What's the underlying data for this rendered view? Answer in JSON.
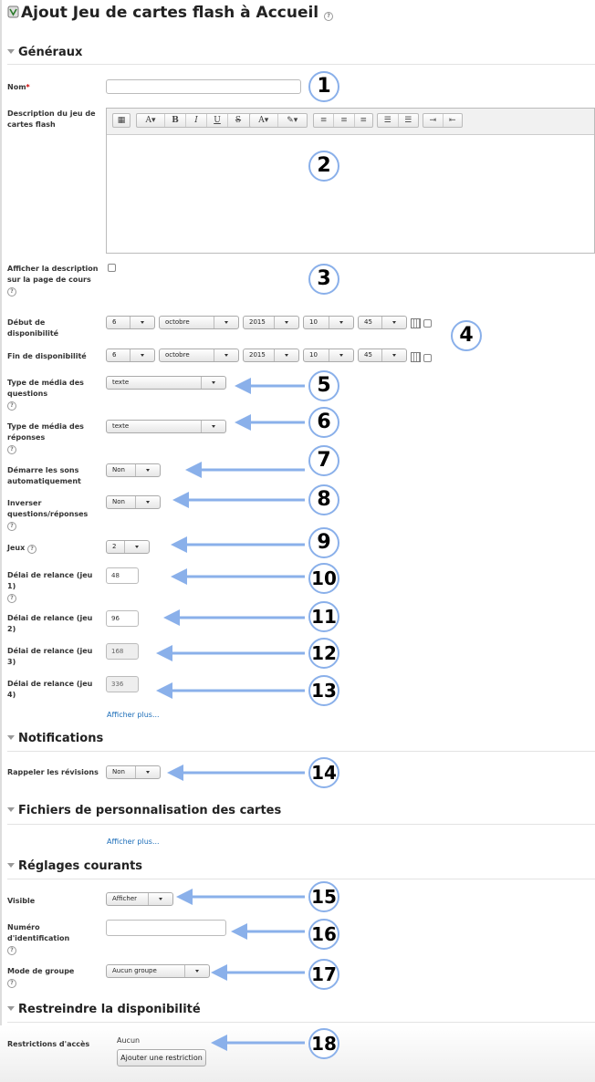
{
  "page": {
    "title": "Ajout Jeu de cartes flash à Accueil"
  },
  "sections": {
    "general": "Généraux",
    "notifications": "Notifications",
    "custom_files": "Fichiers de personnalisation des cartes",
    "common": "Réglages courants",
    "restrict": "Restreindre la disponibilité"
  },
  "labels": {
    "name": "Nom",
    "description": "Description du jeu de cartes flash",
    "show_desc": "Afficher la description sur la page de cours",
    "start": "Début de disponibilité",
    "end": "Fin de disponibilité",
    "q_media": "Type de média des questions",
    "a_media": "Type de média des réponses",
    "autoplay": "Démarre les sons automatiquement",
    "invert": "Inverser questions/réponses",
    "decks": "Jeux",
    "delay1": "Délai de relance (jeu 1)",
    "delay2": "Délai de relance (jeu 2)",
    "delay3": "Délai de relance (jeu 3)",
    "delay4": "Délai de relance (jeu 4)",
    "remind": "Rappeler les révisions",
    "visible": "Visible",
    "idnumber": "Numéro d'identification",
    "groupmode": "Mode de groupe",
    "access": "Restrictions d'accès"
  },
  "values": {
    "name": "",
    "start": {
      "day": "6",
      "month": "octobre",
      "year": "2015",
      "hour": "10",
      "minute": "45"
    },
    "end": {
      "day": "6",
      "month": "octobre",
      "year": "2015",
      "hour": "10",
      "minute": "45"
    },
    "q_media": "texte",
    "a_media": "texte",
    "autoplay": "Non",
    "invert": "Non",
    "decks": "2",
    "delay1": "48",
    "delay2": "96",
    "delay3": "168",
    "delay4": "336",
    "remind": "Non",
    "visible": "Afficher",
    "idnumber": "",
    "groupmode": "Aucun groupe",
    "access": "Aucun"
  },
  "links": {
    "show_more": "Afficher plus..."
  },
  "buttons": {
    "add_restriction": "Ajouter une restriction"
  },
  "callouts": [
    "1",
    "2",
    "3",
    "4",
    "5",
    "6",
    "7",
    "8",
    "9",
    "10",
    "11",
    "12",
    "13",
    "14",
    "15",
    "16",
    "17",
    "18"
  ],
  "colors": {
    "callout": "#8ab0ea",
    "link": "#1a6cb8",
    "required": "#cc0000"
  }
}
